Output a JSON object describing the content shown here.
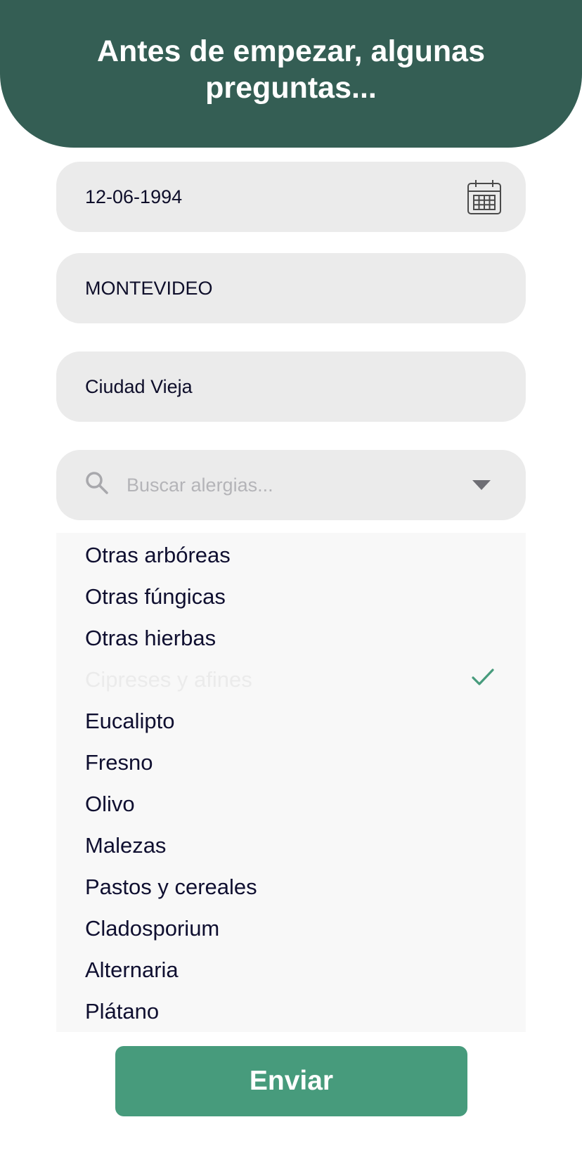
{
  "header": {
    "title": "Antes de empezar, algunas preguntas..."
  },
  "form": {
    "birthdate": {
      "value": "12-06-1994",
      "icon": "calendar-icon"
    },
    "department": {
      "value": "MONTEVIDEO"
    },
    "neighborhood": {
      "value": "Ciudad Vieja"
    },
    "allergy_search": {
      "placeholder": "Buscar alergias...",
      "icon": "search-icon",
      "toggle_icon": "chevron-down-icon"
    }
  },
  "allergies": {
    "options": [
      {
        "label": "Otras arbóreas",
        "selected": false
      },
      {
        "label": "Otras fúngicas",
        "selected": false
      },
      {
        "label": "Otras hierbas",
        "selected": false
      },
      {
        "label": "Cipreses y afines",
        "selected": true
      },
      {
        "label": "Eucalipto",
        "selected": false
      },
      {
        "label": "Fresno",
        "selected": false
      },
      {
        "label": "Olivo",
        "selected": false
      },
      {
        "label": "Malezas",
        "selected": false
      },
      {
        "label": "Pastos y cereales",
        "selected": false
      },
      {
        "label": "Cladosporium",
        "selected": false
      },
      {
        "label": "Alternaria",
        "selected": false
      },
      {
        "label": "Plátano",
        "selected": false
      }
    ]
  },
  "submit": {
    "label": "Enviar"
  },
  "colors": {
    "header_bg": "#345e54",
    "field_bg": "#ebebeb",
    "accent": "#479b7c",
    "text": "#0f0f30"
  }
}
